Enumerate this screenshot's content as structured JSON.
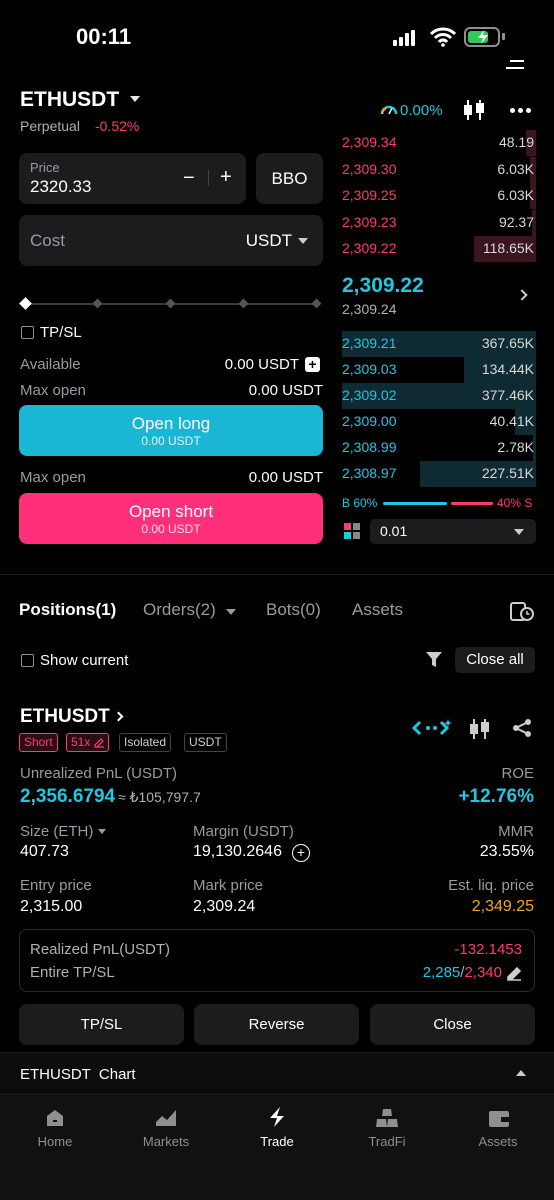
{
  "status": {
    "time": "00:11"
  },
  "header": {
    "pair": "ETHUSDT",
    "type": "Perpetual",
    "change": "-0.52%",
    "funding": "0.00%"
  },
  "order_form": {
    "price_label": "Price",
    "price_value": "2320.33",
    "minus": "−",
    "plus": "+",
    "bbo": "BBO",
    "cost_label": "Cost",
    "cost_unit": "USDT",
    "tpsl_label": "TP/SL",
    "available_label": "Available",
    "available_value": "0.00 USDT",
    "max_open_label": "Max open",
    "max_open_value": "0.00 USDT",
    "open_long": "Open long",
    "open_long_sub": "0.00 USDT",
    "max_open2_label": "Max open",
    "max_open2_value": "0.00 USDT",
    "open_short": "Open short",
    "open_short_sub": "0.00 USDT"
  },
  "orderbook": {
    "asks": [
      {
        "price": "2,309.34",
        "qty": "48.19",
        "depth": 0.05
      },
      {
        "price": "2,309.30",
        "qty": "6.03K",
        "depth": 0.03
      },
      {
        "price": "2,309.25",
        "qty": "6.03K",
        "depth": 0.03
      },
      {
        "price": "2,309.23",
        "qty": "92.37",
        "depth": 0.02
      },
      {
        "price": "2,309.22",
        "qty": "118.65K",
        "depth": 0.32
      }
    ],
    "last_price": "2,309.22",
    "mark_price": "2,309.24",
    "bids": [
      {
        "price": "2,309.21",
        "qty": "367.65K",
        "depth": 1.0
      },
      {
        "price": "2,309.03",
        "qty": "134.44K",
        "depth": 0.37
      },
      {
        "price": "2,309.02",
        "qty": "377.46K",
        "depth": 1.0
      },
      {
        "price": "2,309.00",
        "qty": "40.41K",
        "depth": 0.11
      },
      {
        "price": "2,308.99",
        "qty": "2.78K",
        "depth": 0.01
      },
      {
        "price": "2,308.97",
        "qty": "227.51K",
        "depth": 0.6
      }
    ],
    "buy_ratio": "B 60%",
    "sell_ratio": "40% S",
    "buy_fraction": 0.6,
    "precision": "0.01"
  },
  "tabs": {
    "positions": "Positions(1)",
    "orders": "Orders(2)",
    "bots": "Bots(0)",
    "assets": "Assets"
  },
  "filter": {
    "show_current": "Show current",
    "close_all": "Close all"
  },
  "position": {
    "symbol": "ETHUSDT",
    "side": "Short",
    "leverage": "51x",
    "mode": "Isolated",
    "coin": "USDT",
    "upnl_label": "Unrealized PnL (USDT)",
    "upnl_value": "2,356.6794",
    "upnl_fiat": "≈ ₺105,797.7",
    "roe_label": "ROE",
    "roe_value": "+12.76%",
    "size_label": "Size (ETH)",
    "size_value": "407.73",
    "margin_label": "Margin (USDT)",
    "margin_value": "19,130.2646",
    "mmr_label": "MMR",
    "mmr_value": "23.55%",
    "entry_label": "Entry price",
    "entry_value": "2,315.00",
    "mark_label": "Mark price",
    "mark_value": "2,309.24",
    "liq_label": "Est. liq. price",
    "liq_value": "2,349.25",
    "realized_label": "Realized PnL(USDT)",
    "realized_value": "-132.1453",
    "tpsl_label": "Entire TP/SL",
    "tp_value": "2,285",
    "sl_value": "2,340",
    "btn_tpsl": "TP/SL",
    "btn_reverse": "Reverse",
    "btn_close": "Close"
  },
  "chart_bar": {
    "label": "ETHUSDT  Chart"
  },
  "nav": [
    {
      "label": "Home"
    },
    {
      "label": "Markets"
    },
    {
      "label": "Trade"
    },
    {
      "label": "TradFi"
    },
    {
      "label": "Assets"
    }
  ]
}
